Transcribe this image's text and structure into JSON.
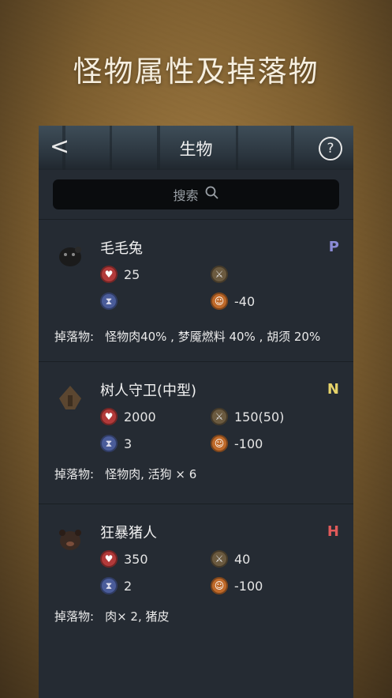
{
  "headline": "怪物属性及掉落物",
  "nav": {
    "title": "生物",
    "back": "<",
    "help": "?"
  },
  "search": {
    "placeholder": "搜索"
  },
  "drops_label": "掉落物:",
  "creatures": [
    {
      "name": "毛毛兔",
      "tier": "P",
      "tier_color": "#8b8bd6",
      "hp": "25",
      "atk": "",
      "spd": "",
      "san": "-40",
      "drops": "怪物肉40% , 梦魇燃料 40% , 胡须 20%"
    },
    {
      "name": "树人守卫(中型)",
      "tier": "N",
      "tier_color": "#e6d36a",
      "hp": "2000",
      "atk": "150(50)",
      "spd": "3",
      "san": "-100",
      "drops": "怪物肉, 活狗 × 6"
    },
    {
      "name": "狂暴猪人",
      "tier": "H",
      "tier_color": "#e05a5a",
      "hp": "350",
      "atk": "40",
      "spd": "2",
      "san": "-100",
      "drops": "肉× 2, 猪皮"
    }
  ]
}
